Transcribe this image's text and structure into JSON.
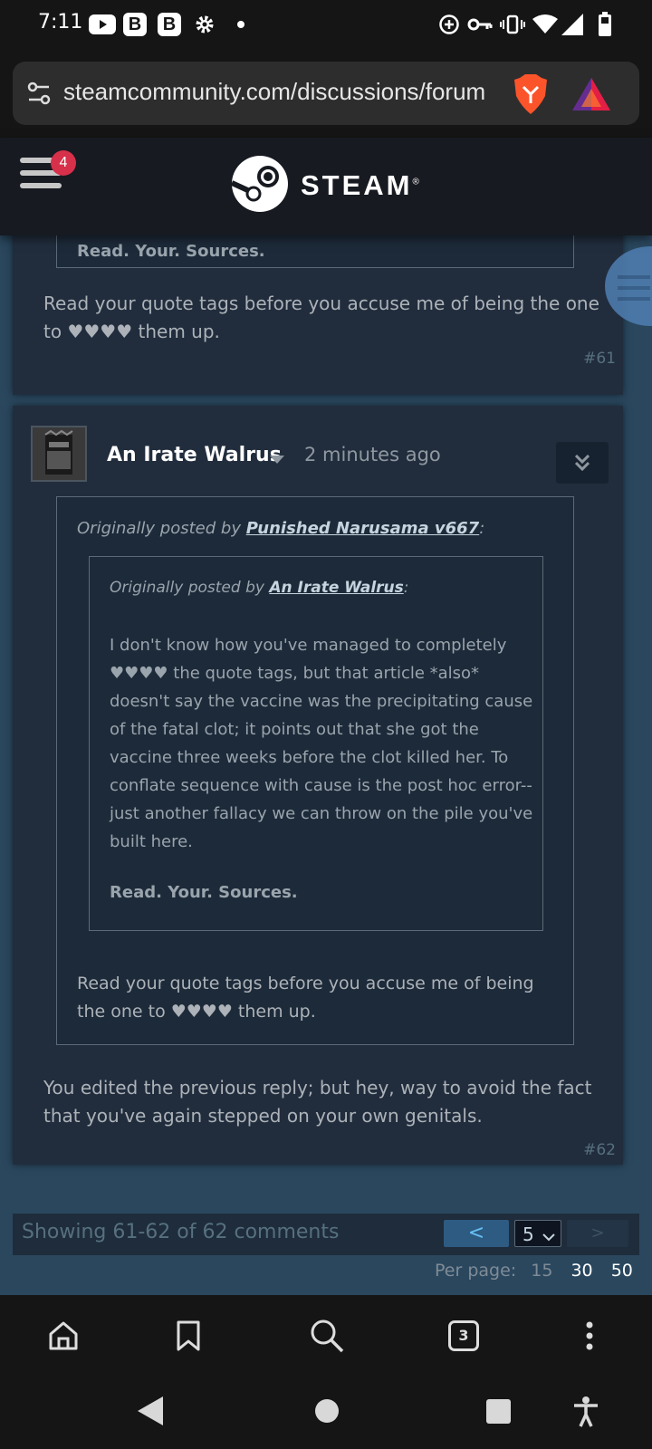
{
  "status": {
    "time": "7:11",
    "b1": "B",
    "b2": "B"
  },
  "browser": {
    "url": "steamcommunity.com/discussions/forum",
    "tab_count": "3"
  },
  "header": {
    "menu_badge": "4",
    "brand": "STEAM",
    "reg_mark": "®"
  },
  "posts": {
    "p61": {
      "prev_quote_tail": "Read. Your. Sources.",
      "body": "Read your quote tags before you accuse me of being the one to ♥♥♥♥ them up.",
      "number": "#61"
    },
    "p62": {
      "author": "An Irate Walrus",
      "time": "2 minutes ago",
      "quote1": {
        "prefix": "Originally posted by ",
        "author": "Punished Narusama v667",
        "suffix": ":",
        "body": "Read your quote tags before you accuse me of being the one to ♥♥♥♥ them up."
      },
      "quote2": {
        "prefix": "Originally posted by ",
        "author": "An Irate Walrus",
        "suffix": ":",
        "body": "I don't know how you've managed to completely ♥♥♥♥ the quote tags, but that article *also* doesn't say the vaccine was the precipitating cause of the fatal clot; it points out that she got the vaccine three weeks before the clot killed her. To conflate sequence with cause is the post hoc error--just another fallacy we can throw on the pile you've built here.",
        "bold": "Read. Your. Sources."
      },
      "body": "You edited the previous reply; but hey, way to avoid the fact that you've again stepped on your own genitals.",
      "number": "#62"
    }
  },
  "pager": {
    "showing": "Showing 61-62 of 62 comments",
    "prev": "<",
    "page": "5",
    "next": ">",
    "per_page_label": "Per page:",
    "opt15": "15",
    "opt30": "30",
    "opt50": "50"
  },
  "colors": {
    "accent_blue": "#66c0f4",
    "badge_red": "#d6304a",
    "post_bg": "#212d3d"
  }
}
